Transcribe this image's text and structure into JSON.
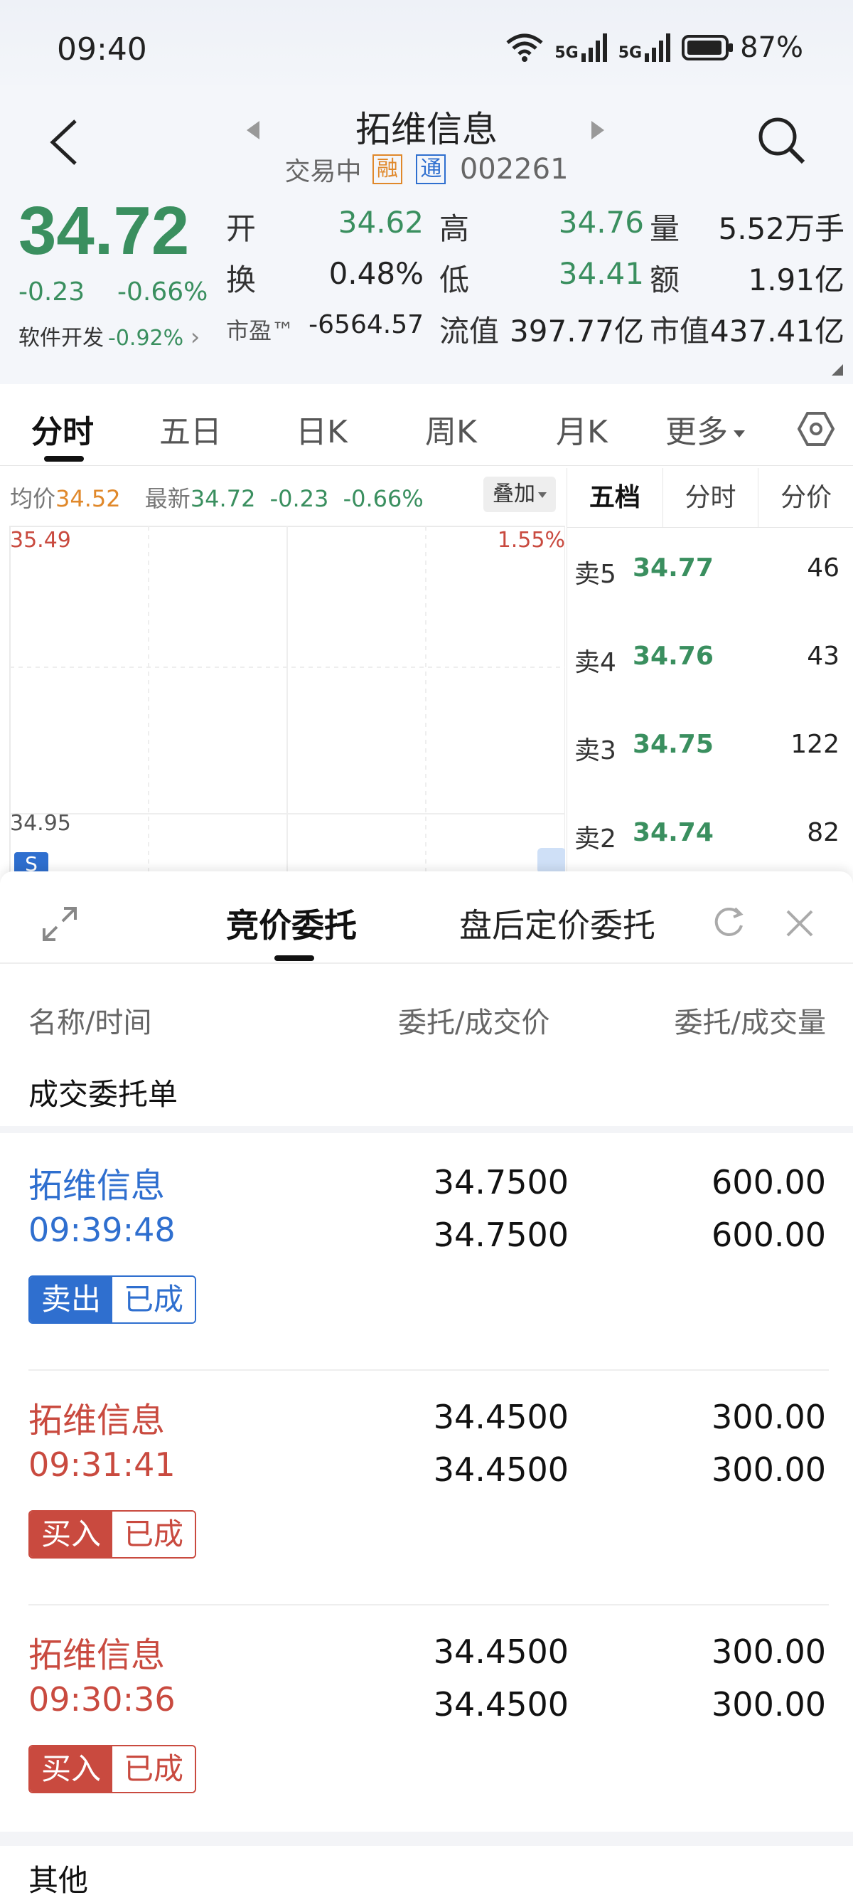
{
  "status_bar": {
    "time": "09:40",
    "battery": "87%",
    "net1": "5G",
    "net2": "5G"
  },
  "header": {
    "title": "拓维信息",
    "trading_status": "交易中",
    "tag_rong": "融",
    "tag_tong": "通",
    "code": "002261"
  },
  "quote": {
    "price": "34.72",
    "change": "-0.23",
    "change_pct": "-0.66%",
    "sector_name": "软件开发",
    "sector_change": "-0.92%",
    "open_label": "开",
    "open_value": "34.62",
    "high_label": "高",
    "high_value": "34.76",
    "volume_label": "量",
    "volume_value": "5.52万手",
    "turnover_label": "换",
    "turnover_value": "0.48%",
    "low_label": "低",
    "low_value": "34.41",
    "amount_label": "额",
    "amount_value": "1.91亿",
    "pe_label": "市盈™",
    "pe_value": "-6564.57",
    "float_cap_label": "流值",
    "float_cap_value": "397.77亿",
    "market_cap_label": "市值",
    "market_cap_value": "437.41亿"
  },
  "tabs": [
    "分时",
    "五日",
    "日K",
    "周K",
    "月K",
    "更多"
  ],
  "chart": {
    "avg_label": "均价",
    "avg_value": "34.52",
    "latest_label": "最新",
    "latest_value": "34.72",
    "latest_change": "-0.23",
    "latest_change_pct": "-0.66%",
    "overlay_button": "叠加",
    "y_top": "35.49",
    "y_top_pct": "1.55%",
    "y_mid": "34.95",
    "s_marker": "S"
  },
  "order_book": {
    "tabs": [
      "五档",
      "分时",
      "分价"
    ],
    "rows": [
      {
        "label": "卖5",
        "price": "34.77",
        "volume": "46"
      },
      {
        "label": "卖4",
        "price": "34.76",
        "volume": "43"
      },
      {
        "label": "卖3",
        "price": "34.75",
        "volume": "122"
      },
      {
        "label": "卖2",
        "price": "34.74",
        "volume": "82"
      }
    ]
  },
  "sheet": {
    "tab_active": "竞价委托",
    "tab_other": "盘后定价委托",
    "col_name": "名称/时间",
    "col_price": "委托/成交价",
    "col_qty": "委托/成交量",
    "section_title": "成交委托单",
    "orders": [
      {
        "name": "拓维信息",
        "time": "09:39:48",
        "order_price": "34.7500",
        "fill_price": "34.7500",
        "order_qty": "600.00",
        "fill_qty": "600.00",
        "side": "卖出",
        "status": "已成"
      },
      {
        "name": "拓维信息",
        "time": "09:31:41",
        "order_price": "34.4500",
        "fill_price": "34.4500",
        "order_qty": "300.00",
        "fill_qty": "300.00",
        "side": "买入",
        "status": "已成"
      },
      {
        "name": "拓维信息",
        "time": "09:30:36",
        "order_price": "34.4500",
        "fill_price": "34.4500",
        "order_qty": "300.00",
        "fill_qty": "300.00",
        "side": "买入",
        "status": "已成"
      }
    ],
    "other_title": "其他"
  },
  "colors": {
    "down": "#3a8f5f",
    "up": "#c94a3f",
    "accent": "#2f6fcf",
    "avg": "#e0882a"
  }
}
